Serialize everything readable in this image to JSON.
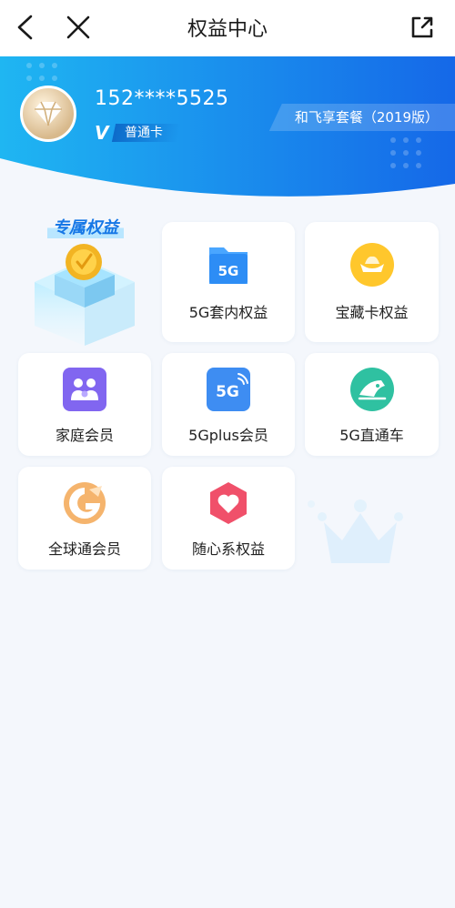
{
  "header": {
    "title": "权益中心"
  },
  "user": {
    "phone": "152****5525",
    "tier": "普通卡",
    "plan": "和飞享套餐（2019版）"
  },
  "section": {
    "title": "专属权益"
  },
  "benefits": [
    {
      "label": "5G套内权益",
      "icon": "5g-folder-icon"
    },
    {
      "label": "宝藏卡权益",
      "icon": "gold-ingot-icon"
    },
    {
      "label": "家庭会员",
      "icon": "family-icon"
    },
    {
      "label": "5Gplus会员",
      "icon": "5g-plus-icon"
    },
    {
      "label": "5G直通车",
      "icon": "train-icon"
    },
    {
      "label": "全球通会员",
      "icon": "global-logo-icon"
    },
    {
      "label": "随心系权益",
      "icon": "heart-hexagon-icon"
    }
  ],
  "colors": {
    "accent": "#1677e6",
    "banner_start": "#1fb6f2",
    "banner_end": "#1568e8",
    "page_bg": "#f4f7fc"
  }
}
